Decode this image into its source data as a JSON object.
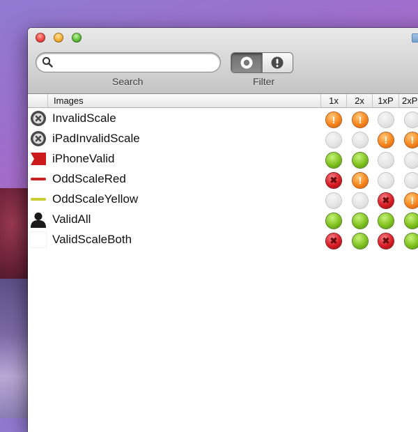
{
  "toolbar": {
    "search_label": "Search",
    "search_value": "",
    "filter_label": "Filter",
    "filter_options": [
      "all",
      "warnings"
    ],
    "filter_selected": "all"
  },
  "table": {
    "columns": [
      "Images",
      "1x",
      "2x",
      "1xP",
      "2xP"
    ],
    "rows": [
      {
        "name": "InvalidScale",
        "icon": "x-circle-icon",
        "status": [
          "warn",
          "warn",
          "none",
          "none"
        ]
      },
      {
        "name": "iPadInvalidScale",
        "icon": "x-circle-icon",
        "status": [
          "none",
          "none",
          "warn",
          "warn"
        ]
      },
      {
        "name": "iPhoneValid",
        "icon": "red-flag-icon",
        "status": [
          "ok",
          "ok",
          "none",
          "none"
        ]
      },
      {
        "name": "OddScaleRed",
        "icon": "red-bar-icon",
        "status": [
          "err",
          "warn",
          "none",
          "none"
        ]
      },
      {
        "name": "OddScaleYellow",
        "icon": "yellow-bar-icon",
        "status": [
          "none",
          "none",
          "err",
          "warn"
        ]
      },
      {
        "name": "ValidAll",
        "icon": "person-silhouette-icon",
        "status": [
          "ok",
          "ok",
          "ok",
          "ok"
        ]
      },
      {
        "name": "ValidScaleBoth",
        "icon": "blank-image-icon",
        "status": [
          "err",
          "ok",
          "err",
          "ok"
        ]
      }
    ]
  },
  "colors": {
    "ok": "#7fc21e",
    "warn": "#f7861e",
    "err": "#d91c24",
    "none": "#e3e3e3"
  }
}
